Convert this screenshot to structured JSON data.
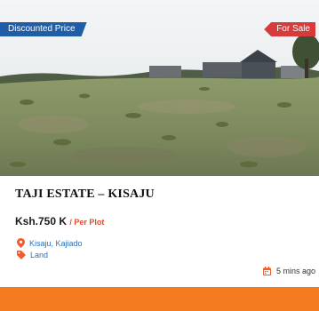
{
  "listing": {
    "badge_left": "Discounted Price",
    "badge_right": "For Sale",
    "title": "TAJI ESTATE – KISAJU",
    "price": "Ksh.750 K",
    "price_unit": "/ Per Plot",
    "location": "Kisaju, Kajiado",
    "category": "Land",
    "posted": "5 mins ago"
  },
  "icons": {
    "location": "map-pin-icon",
    "category": "tag-icon",
    "time": "calendar-icon"
  },
  "colors": {
    "badge_left": "#1f5da6",
    "badge_right": "#d63a3a",
    "price_unit": "#e84a2b",
    "meta_text": "#2f6fb5",
    "icon_accent": "#f25c2a",
    "bottom_bar": "#f47b20"
  }
}
